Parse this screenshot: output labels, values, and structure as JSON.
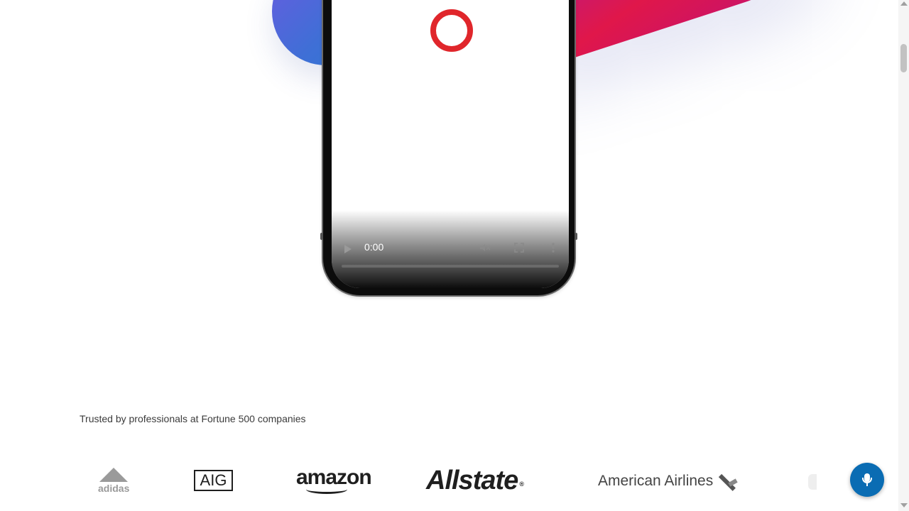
{
  "hero": {
    "video": {
      "time": "0:00",
      "icons": {
        "play": "play-icon",
        "mute": "volume-muted-icon",
        "fullscreen": "fullscreen-icon",
        "more": "more-vertical-icon",
        "loader": "loading-ring-icon"
      },
      "progress": 0
    }
  },
  "trusted": {
    "text": "Trusted by professionals at Fortune 500 companies",
    "logos": [
      {
        "name": "adidas",
        "text": "adidas"
      },
      {
        "name": "AIG",
        "text": "AIG"
      },
      {
        "name": "amazon",
        "text": "amazon"
      },
      {
        "name": "Allstate",
        "text": "Allstate"
      },
      {
        "name": "American Airlines",
        "text": "American Airlines"
      }
    ]
  },
  "assistant": {
    "icon": "microphone-icon"
  },
  "colors": {
    "mic_button": "#0a6cb3",
    "loader": "#e0262b",
    "blob_blue": "#3f6fd6",
    "blob_magenta": "#c21a79"
  }
}
